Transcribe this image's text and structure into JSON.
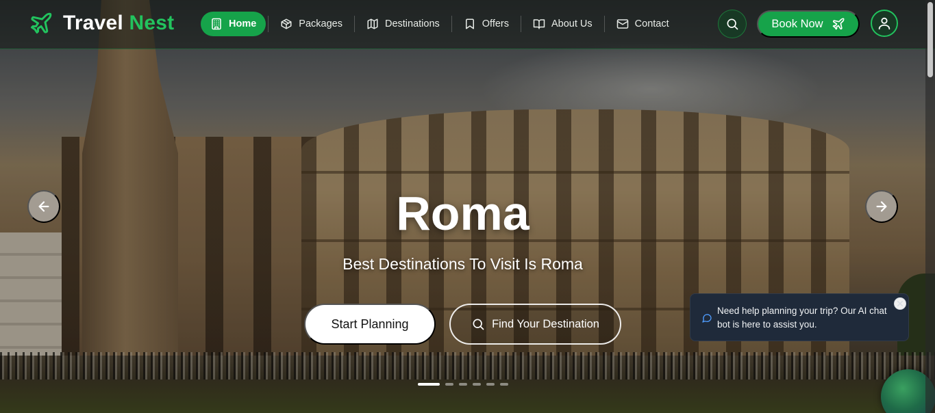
{
  "brand": {
    "name_part1": "Travel",
    "name_part2": "Nest",
    "accent_color": "#22c35e"
  },
  "nav": {
    "items": [
      {
        "label": "Home",
        "icon": "building-icon",
        "active": true
      },
      {
        "label": "Packages",
        "icon": "box-icon",
        "active": false
      },
      {
        "label": "Destinations",
        "icon": "map-icon",
        "active": false
      },
      {
        "label": "Offers",
        "icon": "bookmark-icon",
        "active": false
      },
      {
        "label": "About Us",
        "icon": "book-open-icon",
        "active": false
      },
      {
        "label": "Contact",
        "icon": "mail-icon",
        "active": false
      }
    ]
  },
  "header_actions": {
    "search_icon": "search-icon",
    "book_label": "Book Now",
    "book_icon": "plane-icon",
    "profile_icon": "user-icon"
  },
  "hero": {
    "title": "Roma",
    "subtitle": "Best Destinations To Visit Is Roma",
    "primary_cta": "Start Planning",
    "secondary_cta": "Find Your Destination",
    "slide_count": 6,
    "active_slide": 1
  },
  "chat": {
    "message": "Need help planning your trip? Our AI chat bot is here to assist you."
  },
  "colors": {
    "primary_green": "#16a34a",
    "chat_bg": "#1f2a3a"
  }
}
